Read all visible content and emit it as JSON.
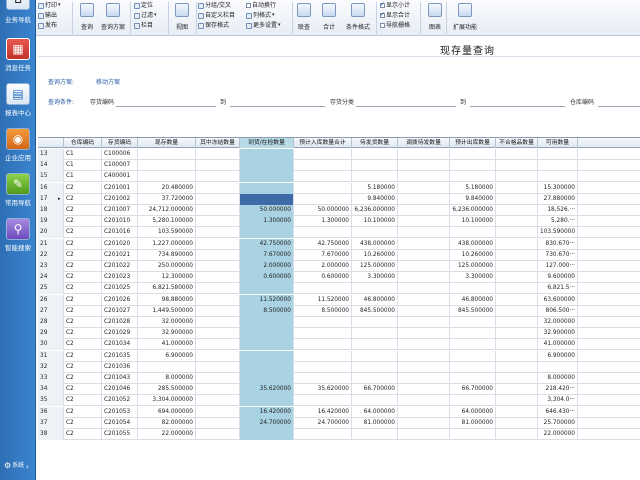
{
  "ribbon": {
    "col1": [
      "打印",
      "输出",
      "发布"
    ],
    "col2": [
      "查询",
      "查询方案"
    ],
    "col3": [
      "定位",
      "过滤",
      "栏目"
    ],
    "col4": "视图",
    "col5": [
      "分组/交叉",
      "自定义栏目",
      "保存格式"
    ],
    "col6": [
      "自动换行",
      "列格式",
      "更多设置"
    ],
    "col7": [
      "联查",
      "合计",
      "条件格式"
    ],
    "col8": [
      "显示小计",
      "显示合计",
      "导航栅格"
    ],
    "col9": [
      "图表",
      "扩展功能"
    ]
  },
  "nav": [
    "业务导航",
    "消息任务",
    "报表中心",
    "企业应用",
    "常用导航",
    "智能搜索"
  ],
  "footer": {
    "settings": "系统"
  },
  "title": "现存量查询",
  "query": {
    "scheme_label": "查询方案:",
    "scheme_value": "移动方案",
    "cond_label": "查询条件:",
    "inv_code_label": "存货编码",
    "to1": "到",
    "inv_class_label": "存货分类",
    "to2": "到",
    "location_label": "仓库编码"
  },
  "columns": [
    "",
    "仓库编码",
    "存货编码",
    "现存数量",
    "其中冻结数量",
    "到货/在检数量",
    "预计入库数量合计",
    "待发货数量",
    "调拨待发数量",
    "预计出库数量",
    "不合格品数量",
    "可用数量"
  ],
  "rows": [
    {
      "no": "13",
      "wh": "C1",
      "inv": "C100006",
      "c": [
        "",
        "",
        "",
        "",
        "",
        "",
        "",
        "",
        ""
      ]
    },
    {
      "no": "14",
      "wh": "C1",
      "inv": "C100007",
      "c": [
        "",
        "",
        "",
        "",
        "",
        "",
        "",
        "",
        ""
      ]
    },
    {
      "no": "15",
      "wh": "C1",
      "inv": "C400001",
      "c": [
        "",
        "",
        "",
        "",
        "",
        "",
        "",
        "",
        ""
      ]
    },
    {
      "no": "16",
      "wh": "C2",
      "inv": "C201001",
      "c": [
        "20.480000",
        "",
        "",
        "",
        "5.180000",
        "",
        "5.180000",
        "",
        "15.300000"
      ]
    },
    {
      "no": "17",
      "wh": "C2",
      "inv": "C201002",
      "c": [
        "37.720000",
        "",
        "",
        "",
        "9.840000",
        "",
        "9.840000",
        "",
        "27.880000"
      ]
    },
    {
      "no": "18",
      "wh": "C2",
      "inv": "C201007",
      "c": [
        "24,712.000000",
        "",
        "50.000000",
        "50.000000",
        "6,236.000000",
        "",
        "6,236.000000",
        "",
        "18,526.···"
      ]
    },
    {
      "no": "19",
      "wh": "C2",
      "inv": "C201010",
      "c": [
        "5,280.100000",
        "",
        "1.300000",
        "1.300000",
        "10.100000",
        "",
        "10.100000",
        "",
        "5,280.···"
      ]
    },
    {
      "no": "20",
      "wh": "C2",
      "inv": "C201016",
      "c": [
        "103.590000",
        "",
        "",
        "",
        "",
        "",
        "",
        "",
        "103.590000"
      ]
    },
    {
      "no": "21",
      "wh": "C2",
      "inv": "C201020",
      "c": [
        "1,227.000000",
        "",
        "42.750000",
        "42.750000",
        "438.000000",
        "",
        "438.000000",
        "",
        "830.670···"
      ]
    },
    {
      "no": "22",
      "wh": "C2",
      "inv": "C201021",
      "c": [
        "734.890000",
        "",
        "7.670000",
        "7.670000",
        "10.260000",
        "",
        "10.260000",
        "",
        "730.670···"
      ]
    },
    {
      "no": "23",
      "wh": "C2",
      "inv": "C201022",
      "c": [
        "250.000000",
        "",
        "2.000000",
        "2.000000",
        "125.000000",
        "",
        "125.000000",
        "",
        "127.000···"
      ]
    },
    {
      "no": "24",
      "wh": "C2",
      "inv": "C201023",
      "c": [
        "12.300000",
        "",
        "0.600000",
        "0.600000",
        "3.300000",
        "",
        "3.300000",
        "",
        "9.600000"
      ]
    },
    {
      "no": "25",
      "wh": "C2",
      "inv": "C201025",
      "c": [
        "6,821.580000",
        "",
        "",
        "",
        "",
        "",
        "",
        "",
        "6,821.5···"
      ]
    },
    {
      "no": "26",
      "wh": "C2",
      "inv": "C201026",
      "c": [
        "98.880000",
        "",
        "11.520000",
        "11.520000",
        "46.800000",
        "",
        "46.800000",
        "",
        "63.600000"
      ]
    },
    {
      "no": "27",
      "wh": "C2",
      "inv": "C201027",
      "c": [
        "1,449.500000",
        "",
        "8.500000",
        "8.500000",
        "845.500000",
        "",
        "845.500000",
        "",
        "806.500···"
      ]
    },
    {
      "no": "28",
      "wh": "C2",
      "inv": "C201028",
      "c": [
        "32.000000",
        "",
        "",
        "",
        "",
        "",
        "",
        "",
        "32.000000"
      ]
    },
    {
      "no": "29",
      "wh": "C2",
      "inv": "C201029",
      "c": [
        "32.900000",
        "",
        "",
        "",
        "",
        "",
        "",
        "",
        "32.900000"
      ]
    },
    {
      "no": "30",
      "wh": "C2",
      "inv": "C201034",
      "c": [
        "41.000000",
        "",
        "",
        "",
        "",
        "",
        "",
        "",
        "41.000000"
      ]
    },
    {
      "no": "31",
      "wh": "C2",
      "inv": "C201035",
      "c": [
        "6.900000",
        "",
        "",
        "",
        "",
        "",
        "",
        "",
        "6.900000"
      ]
    },
    {
      "no": "32",
      "wh": "C2",
      "inv": "C201036",
      "c": [
        "",
        "",
        "",
        "",
        "",
        "",
        "",
        "",
        ""
      ]
    },
    {
      "no": "33",
      "wh": "C2",
      "inv": "C201043",
      "c": [
        "8.000000",
        "",
        "",
        "",
        "",
        "",
        "",
        "",
        "8.000000"
      ]
    },
    {
      "no": "34",
      "wh": "C2",
      "inv": "C201046",
      "c": [
        "285.500000",
        "",
        "35.620000",
        "35.620000",
        "66.700000",
        "",
        "66.700000",
        "",
        "218.420···"
      ]
    },
    {
      "no": "35",
      "wh": "C2",
      "inv": "C201052",
      "c": [
        "3,304.000000",
        "",
        "",
        "",
        "",
        "",
        "",
        "",
        "3,304.0···"
      ]
    },
    {
      "no": "36",
      "wh": "C2",
      "inv": "C201053",
      "c": [
        "694.000000",
        "",
        "16.420000",
        "16.420000",
        "64.000000",
        "",
        "64.000000",
        "",
        "646.430···"
      ]
    },
    {
      "no": "37",
      "wh": "C2",
      "inv": "C201054",
      "c": [
        "82.000000",
        "",
        "24.700000",
        "24.700000",
        "81.000000",
        "",
        "81.000000",
        "",
        "25.700000"
      ]
    },
    {
      "no": "38",
      "wh": "C2",
      "inv": "C201055",
      "c": [
        "22.000000",
        "",
        "",
        "",
        "",
        "",
        "",
        "",
        "22.000000"
      ]
    }
  ]
}
